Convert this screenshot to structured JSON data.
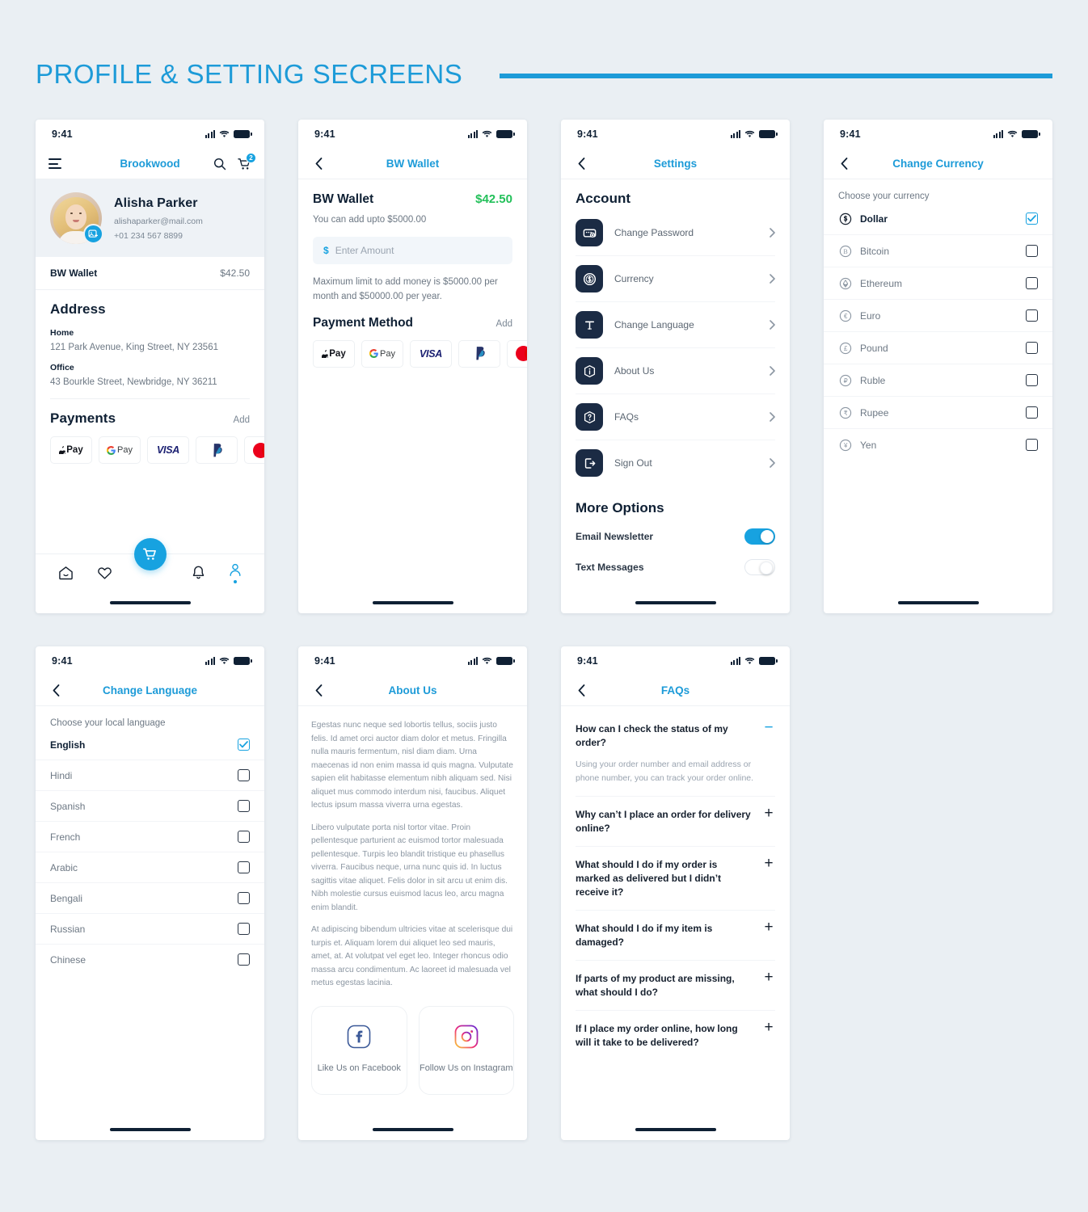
{
  "page": {
    "title": "PROFILE & SETTING SECREENS",
    "accent": "#1d9bd8",
    "background": "#eaeff3"
  },
  "status_bar": {
    "time": "9:41"
  },
  "screen_profile": {
    "nav": {
      "brand": "Brookwood",
      "search_icon": "search-icon",
      "cart_icon": "cart-icon",
      "cart_badge": "2",
      "menu_icon": "hamburger-icon"
    },
    "user": {
      "name": "Alisha Parker",
      "email": "alishaparker@mail.com",
      "phone": "+01 234 567 8899",
      "edit_badge_icon": "image-add-icon"
    },
    "wallet_row": {
      "label": "BW Wallet",
      "value": "$42.50"
    },
    "address": {
      "heading": "Address",
      "entries": [
        {
          "label": "Home",
          "text": "121 Park Avenue, King Street, NY 23561"
        },
        {
          "label": "Office",
          "text": "43 Bourkle Street, Newbridge, NY 36211"
        }
      ]
    },
    "payments": {
      "heading": "Payments",
      "add_label": "Add",
      "methods": [
        "Apple Pay",
        "G Pay",
        "VISA",
        "PayPal",
        "Mastercard"
      ]
    },
    "bottom_nav": [
      {
        "name": "home",
        "icon": "home-icon",
        "active": false
      },
      {
        "name": "wishlist",
        "icon": "heart-icon",
        "active": false
      },
      {
        "name": "cart",
        "icon": "cart-icon",
        "active": false
      },
      {
        "name": "notifications",
        "icon": "bell-icon",
        "active": false
      },
      {
        "name": "profile",
        "icon": "user-icon",
        "active": true
      }
    ]
  },
  "screen_wallet": {
    "nav_title": "BW Wallet",
    "title": "BW Wallet",
    "amount": "$42.50",
    "subtitle": "You can add upto $5000.00",
    "input": {
      "currency_symbol": "$",
      "placeholder": "Enter Amount",
      "value": ""
    },
    "note": "Maximum limit to add money is $5000.00 per month and $50000.00 per year.",
    "payment_method": {
      "heading": "Payment Method",
      "add_label": "Add",
      "methods": [
        "Apple Pay",
        "G Pay",
        "VISA",
        "PayPal",
        "Mastercard"
      ]
    }
  },
  "screen_settings": {
    "nav_title": "Settings",
    "account_heading": "Account",
    "items": [
      {
        "label": "Change Password",
        "icon": "password-icon"
      },
      {
        "label": "Currency",
        "icon": "dollar-coin-icon"
      },
      {
        "label": "Change Language",
        "icon": "text-t-icon"
      },
      {
        "label": "About Us",
        "icon": "info-icon"
      },
      {
        "label": "FAQs",
        "icon": "question-icon"
      },
      {
        "label": "Sign Out",
        "icon": "logout-icon"
      }
    ],
    "more_heading": "More Options",
    "toggles": [
      {
        "label": "Email Newsletter",
        "on": true
      },
      {
        "label": "Text Messages",
        "on": false
      }
    ]
  },
  "screen_currency": {
    "nav_title": "Change Currency",
    "lead": "Choose your currency",
    "options": [
      {
        "label": "Dollar",
        "symbol": "$",
        "selected": true
      },
      {
        "label": "Bitcoin",
        "symbol": "B",
        "selected": false
      },
      {
        "label": "Ethereum",
        "symbol": "Ξ",
        "selected": false
      },
      {
        "label": "Euro",
        "symbol": "€",
        "selected": false
      },
      {
        "label": "Pound",
        "symbol": "£",
        "selected": false
      },
      {
        "label": "Ruble",
        "symbol": "₽",
        "selected": false
      },
      {
        "label": "Rupee",
        "symbol": "₹",
        "selected": false
      },
      {
        "label": "Yen",
        "symbol": "¥",
        "selected": false
      }
    ]
  },
  "screen_language": {
    "nav_title": "Change Language",
    "lead": "Choose your local language",
    "options": [
      {
        "label": "English",
        "selected": true
      },
      {
        "label": "Hindi",
        "selected": false
      },
      {
        "label": "Spanish",
        "selected": false
      },
      {
        "label": "French",
        "selected": false
      },
      {
        "label": "Arabic",
        "selected": false
      },
      {
        "label": "Bengali",
        "selected": false
      },
      {
        "label": "Russian",
        "selected": false
      },
      {
        "label": "Chinese",
        "selected": false
      }
    ]
  },
  "screen_about": {
    "nav_title": "About Us",
    "paragraphs": [
      "Egestas nunc neque sed lobortis tellus, sociis justo felis. Id amet orci auctor diam dolor et metus. Fringilla nulla mauris fermentum, nisl diam diam. Urna maecenas id non enim massa id quis magna. Vulputate sapien elit habitasse elementum nibh aliquam sed. Nisi aliquet mus commodo interdum nisi, faucibus. Aliquet lectus ipsum massa viverra urna egestas.",
      "Libero vulputate porta nisl tortor vitae. Proin pellentesque parturient ac euismod tortor malesuada pellentesque. Turpis leo blandit tristique eu phasellus viverra. Faucibus neque, urna nunc quis id. In luctus sagittis vitae aliquet. Felis dolor in sit arcu ut enim dis. Nibh molestie cursus euismod lacus leo, arcu magna enim blandit.",
      "At adipiscing bibendum ultricies vitae at scelerisque dui turpis et. Aliquam lorem dui aliquet leo sed mauris, amet, at. At volutpat vel eget leo. Integer rhoncus odio massa arcu condimentum. Ac laoreet id malesuada vel metus egestas lacinia."
    ],
    "social": [
      {
        "label": "Like Us on Facebook",
        "icon": "facebook-icon"
      },
      {
        "label": "Follow Us on Instagram",
        "icon": "instagram-icon"
      }
    ]
  },
  "screen_faqs": {
    "nav_title": "FAQs",
    "items": [
      {
        "question": "How can I check the status of my order?",
        "answer": "Using your order number and email address or phone number, you can track your order online.",
        "expanded": true
      },
      {
        "question": "Why can’t I place an order for delivery online?",
        "answer": "",
        "expanded": false
      },
      {
        "question": "What should I do if my order is marked as delivered but I didn’t receive it?",
        "answer": "",
        "expanded": false
      },
      {
        "question": "What should I do if my item is damaged?",
        "answer": "",
        "expanded": false
      },
      {
        "question": "If parts of my product are missing, what should I do?",
        "answer": "",
        "expanded": false
      },
      {
        "question": "If I place my order online, how long will it take to be delivered?",
        "answer": "",
        "expanded": false
      }
    ]
  }
}
